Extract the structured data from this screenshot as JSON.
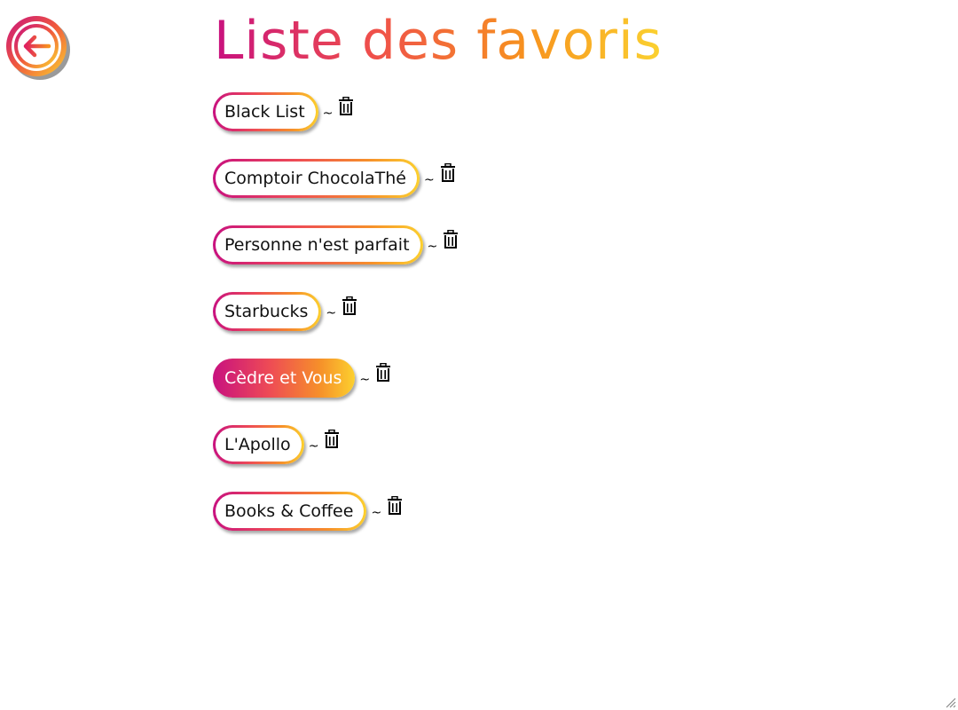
{
  "header": {
    "title": "Liste des favoris",
    "back_icon": "arrow-left-circle-icon"
  },
  "colors": {
    "gradient_start": "#c8117f",
    "gradient_mid": "#ef4f4b",
    "gradient_end": "#fbd230"
  },
  "favorites": [
    {
      "label": "Black List",
      "separator": "~",
      "delete_icon": "trash-icon",
      "selected": false
    },
    {
      "label": "Comptoir ChocolaThé",
      "separator": "~",
      "delete_icon": "trash-icon",
      "selected": false
    },
    {
      "label": "Personne n'est parfait",
      "separator": "~",
      "delete_icon": "trash-icon",
      "selected": false
    },
    {
      "label": "Starbucks",
      "separator": "~",
      "delete_icon": "trash-icon",
      "selected": false
    },
    {
      "label": "Cèdre et Vous",
      "separator": "~",
      "delete_icon": "trash-icon",
      "selected": true
    },
    {
      "label": "L'Apollo",
      "separator": "~",
      "delete_icon": "trash-icon",
      "selected": false
    },
    {
      "label": "Books & Coffee",
      "separator": "~",
      "delete_icon": "trash-icon",
      "selected": false
    }
  ]
}
